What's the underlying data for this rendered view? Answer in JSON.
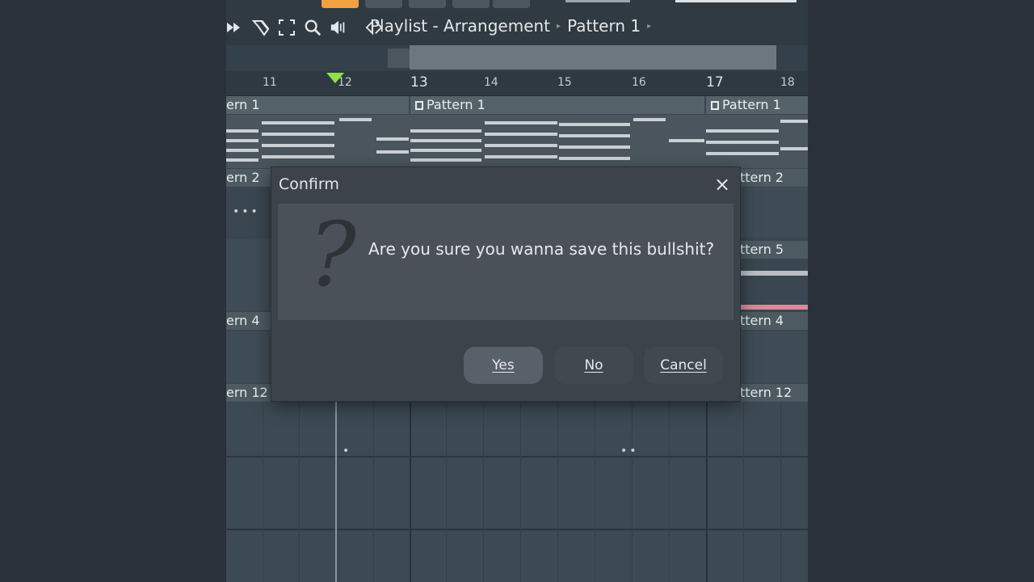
{
  "header": {
    "crumb": [
      "Playlist - Arrangement",
      "Pattern 1"
    ],
    "icons": [
      "play-arrows-icon",
      "paint-brush-icon",
      "select-icon",
      "zoom-icon",
      "speaker-icon",
      "sound-toggle-icon"
    ]
  },
  "ruler": {
    "bars": [
      "11",
      "12",
      "13",
      "14",
      "15",
      "16",
      "17",
      "18"
    ]
  },
  "tracks": {
    "left_labels": [
      "ern 1",
      "ern 2",
      "ern 4",
      "ern 12"
    ],
    "right_labels": [
      "ttern 2",
      "ttern 5",
      "ttern 4",
      "ttern 12"
    ],
    "clips": [
      "Pattern 1",
      "Pattern 1"
    ]
  },
  "dialog": {
    "title": "Confirm",
    "close": "×",
    "icon": "question-mark-icon",
    "question_glyph": "?",
    "message": "Are you sure you wanna save this bullshit?",
    "buttons": {
      "yes": "Yes",
      "no": "No",
      "cancel": "Cancel"
    }
  },
  "colors": {
    "background": "#2b313a",
    "accent_orange": "#f0a040",
    "playhead_green": "#8ee04a"
  }
}
